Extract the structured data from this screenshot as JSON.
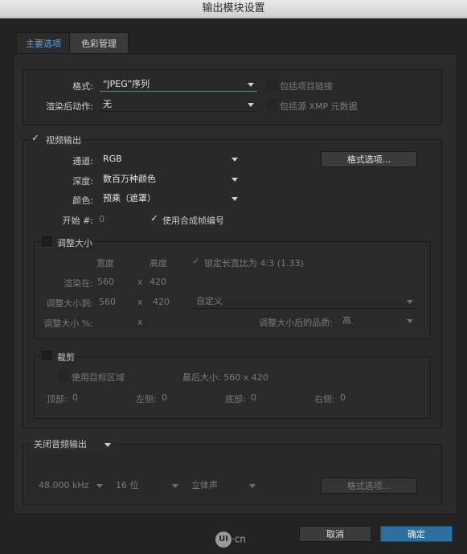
{
  "window": {
    "title": "输出模块设置"
  },
  "tabs": [
    {
      "label": "主要选项"
    },
    {
      "label": "色彩管理"
    }
  ],
  "format_section": {
    "format_label": "格式:",
    "format_value": "“JPEG”序列",
    "post_render_label": "渲染后动作:",
    "post_render_value": "无",
    "include_project_link": "包括项目链接",
    "include_xmp": "包括源 XMP 元数据"
  },
  "video": {
    "checkbox_label": "视频输出",
    "checked_mark": "✓",
    "channels_label": "通道:",
    "channels_value": "RGB",
    "depth_label": "深度:",
    "depth_value": "数百万种颜色",
    "color_label": "颜色:",
    "color_value": "预乘（遮罩）",
    "start_label": "开始 #:",
    "start_value": "0",
    "use_comp_frame": "使用合成帧编号",
    "format_options_button": "格式选项..."
  },
  "resize": {
    "checkbox_label": "调整大小",
    "width_header": "宽度",
    "height_header": "高度",
    "lock_aspect": "锁定长宽比为 4:3 (1.33)",
    "render_at_label": "渲染在:",
    "render_w": "560",
    "render_h": "420",
    "resize_to_label": "调整大小到:",
    "resize_w": "560",
    "resize_h": "420",
    "times": "x",
    "preset_value": "自定义",
    "resize_pct_label": "调整大小 %:",
    "quality_label": "调整大小后的品质:",
    "quality_value": "高"
  },
  "crop": {
    "checkbox_label": "裁剪",
    "use_roi": "使用目标区域",
    "final_size": "最后大小: 560 x 420",
    "top_label": "顶部:",
    "top_value": "0",
    "left_label": "左侧:",
    "left_value": "0",
    "bottom_label": "底部:",
    "bottom_value": "0",
    "right_label": "右侧:",
    "right_value": "0"
  },
  "audio": {
    "output_value": "关闭音频输出",
    "sample_rate": "48.000 kHz",
    "bit_depth": "16 位",
    "channels": "立体声",
    "format_options_button": "格式选项..."
  },
  "footer": {
    "cancel": "取消",
    "ok": "确定",
    "watermark_badge": "UI",
    "watermark_text": "·cn"
  },
  "colors": {
    "accent": "#3d8fd1",
    "tab_active": "#5aa8e6",
    "ok_button": "#2f6f9f"
  }
}
